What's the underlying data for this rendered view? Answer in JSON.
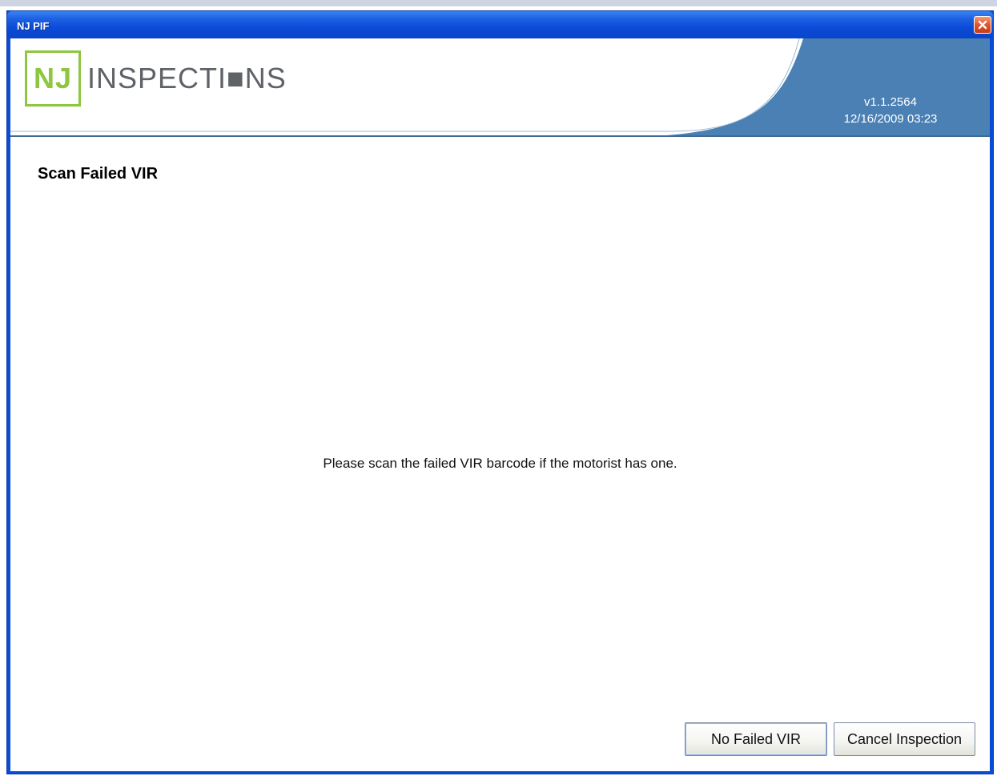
{
  "window": {
    "title": "NJ PIF"
  },
  "header": {
    "logo_nj": "NJ",
    "logo_text": "INSPECTI■NS",
    "version": "v1.1.2564",
    "datetime": "12/16/2009 03:23"
  },
  "page": {
    "title": "Scan Failed VIR",
    "message": "Please scan the failed VIR barcode if the motorist has one."
  },
  "buttons": {
    "no_failed_vir": "No Failed VIR",
    "cancel_inspection": "Cancel Inspection"
  },
  "colors": {
    "titlebar": "#0a4bd8",
    "header_blue": "#4a80b4",
    "logo_green": "#8dc63f",
    "close_red": "#e0542c"
  },
  "icons": {
    "close": "close-icon"
  }
}
